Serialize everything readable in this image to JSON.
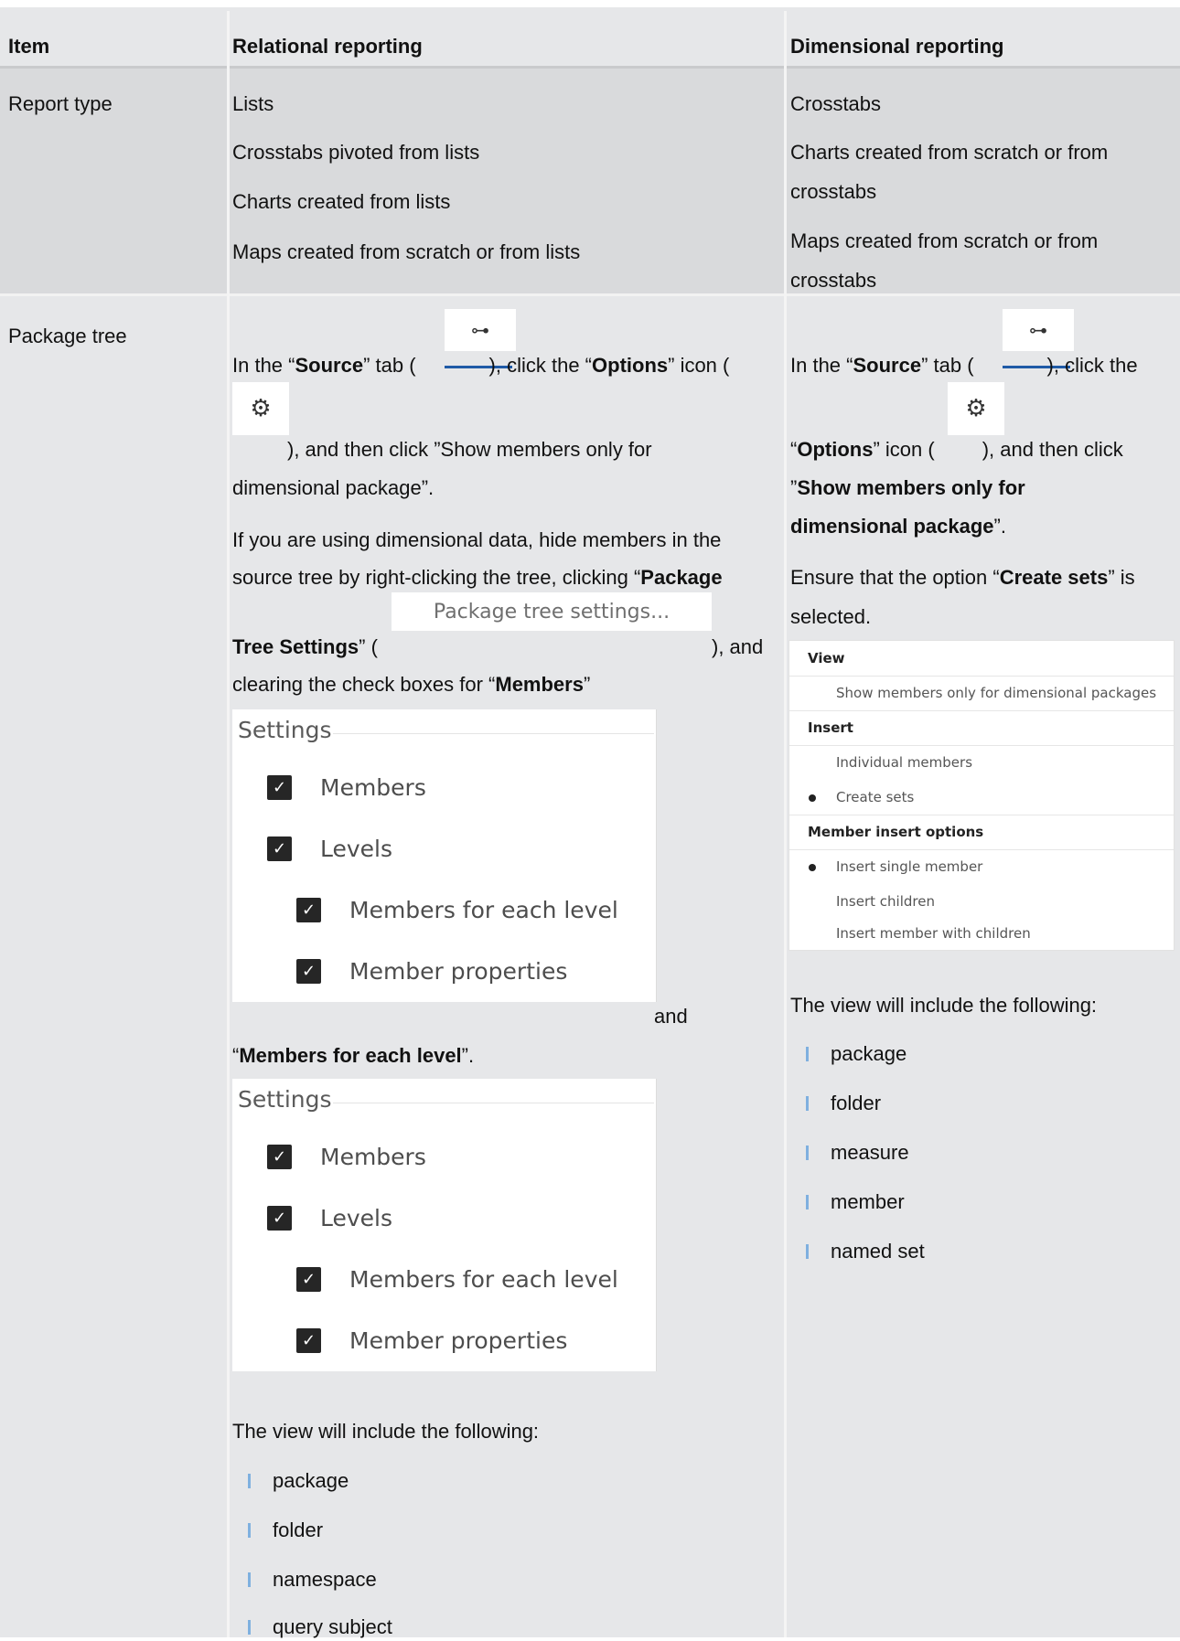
{
  "headers": {
    "item": "Item",
    "relational": "Relational reporting",
    "dimensional": "Dimensional reporting"
  },
  "report_type": {
    "label": "Report type",
    "relational": [
      "Lists",
      "Crosstabs pivoted from lists",
      "Charts created from lists",
      "Maps created from scratch or from lists"
    ],
    "dimensional": [
      "Crosstabs",
      "Charts created from scratch or from",
      "crosstabs",
      "Maps created from scratch or from",
      "crosstabs"
    ]
  },
  "package_tree": {
    "label": "Package tree",
    "rel": {
      "p1_in_the": "In the “",
      "p1_source": "Source",
      "p1_tab": "” tab (",
      "p1_click_the": "), click the “",
      "p1_options": "Options",
      "p1_icon": "” icon (",
      "p1_and_then": "), and then click ”Show members only for",
      "p1_end": "dimensional package”.",
      "p2_line1": "If you are using dimensional data, hide members in the",
      "p2_line2_a": "source tree by right-clicking the tree, clicking “",
      "p2_line2_b": "Package",
      "p2_line3_a": "Tree Settings",
      "p2_line3_b": "” (",
      "p2_line3_c": "), and",
      "p2_line4_a": "clearing the check boxes for “",
      "p2_line4_b": "Members",
      "p2_line4_c": "”",
      "and_word": "and",
      "p3_a": "“",
      "p3_b": "Members for each level",
      "p3_c": "”.",
      "view_intro": "The view will include the following:",
      "view_items": [
        "package",
        "folder",
        "namespace",
        "query subject"
      ]
    },
    "dim": {
      "p1_in_the": "In the “",
      "p1_source": "Source",
      "p1_tab": "” tab (",
      "p1_click_the": "), click the",
      "p2_a": "“",
      "p2_options": "Options",
      "p2_icon": "” icon (",
      "p2_and_then": "), and then click",
      "p3_a": "”",
      "p3_b": "Show members only for",
      "p4_b": "dimensional package",
      "p4_c": "”.",
      "p5_a": "Ensure that the option “",
      "p5_b": "Create sets",
      "p5_c": "” is",
      "p6": "selected.",
      "view_intro": "The view will include the following:",
      "view_items": [
        "package",
        "folder",
        "measure",
        "member",
        "named set"
      ]
    },
    "package_tree_settings_button": "Package tree settings...",
    "tree_icon": "source-tree-icon",
    "options_icon": "gear-icon",
    "settings_panel": {
      "title": "Settings",
      "items": [
        "Members",
        "Levels",
        "Members for each level",
        "Member properties"
      ],
      "checked": [
        true,
        true,
        true,
        true
      ]
    },
    "view_panel": {
      "view_label": "View",
      "view_item": "Show members only for dimensional packages",
      "insert_label": "Insert",
      "insert_items": [
        "Individual members",
        "Create sets"
      ],
      "insert_selected": "Create sets",
      "member_insert_label": "Member insert options",
      "member_insert_items": [
        "Insert single member",
        "Insert children",
        "Insert member with children"
      ],
      "member_insert_selected": "Insert single member"
    }
  }
}
